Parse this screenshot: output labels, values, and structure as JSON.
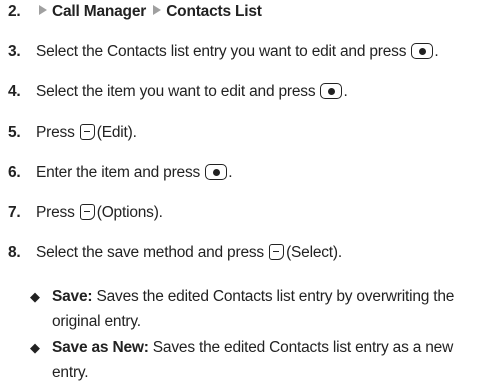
{
  "steps": [
    {
      "number": "2.",
      "path": [
        "Call Manager",
        "Contacts List"
      ]
    },
    {
      "number": "3.",
      "text": "Select the Contacts list entry you want to edit and press",
      "after": "."
    },
    {
      "number": "4.",
      "text": "Select the item you want to edit and press",
      "after": "."
    },
    {
      "number": "5.",
      "text": "Press",
      "after": "(Edit)."
    },
    {
      "number": "6.",
      "text": "Enter the item and press",
      "after": "."
    },
    {
      "number": "7.",
      "text": "Press",
      "after": "(Options)."
    },
    {
      "number": "8.",
      "text": "Select the save method and press",
      "after": "(Select)."
    }
  ],
  "bullets": [
    {
      "term": "Save:",
      "line1": "Saves the edited Contacts list entry by overwriting the",
      "line2": "original entry."
    },
    {
      "term": "Save as New:",
      "line1": "Saves the edited Contacts list entry as a new",
      "line2": "entry."
    }
  ],
  "icons": {
    "menu_arrow": "triangle-right-icon",
    "center_key": "center-select-key-icon",
    "soft_key": "left-soft-key-icon",
    "bullet": "diamond-bullet-icon"
  }
}
